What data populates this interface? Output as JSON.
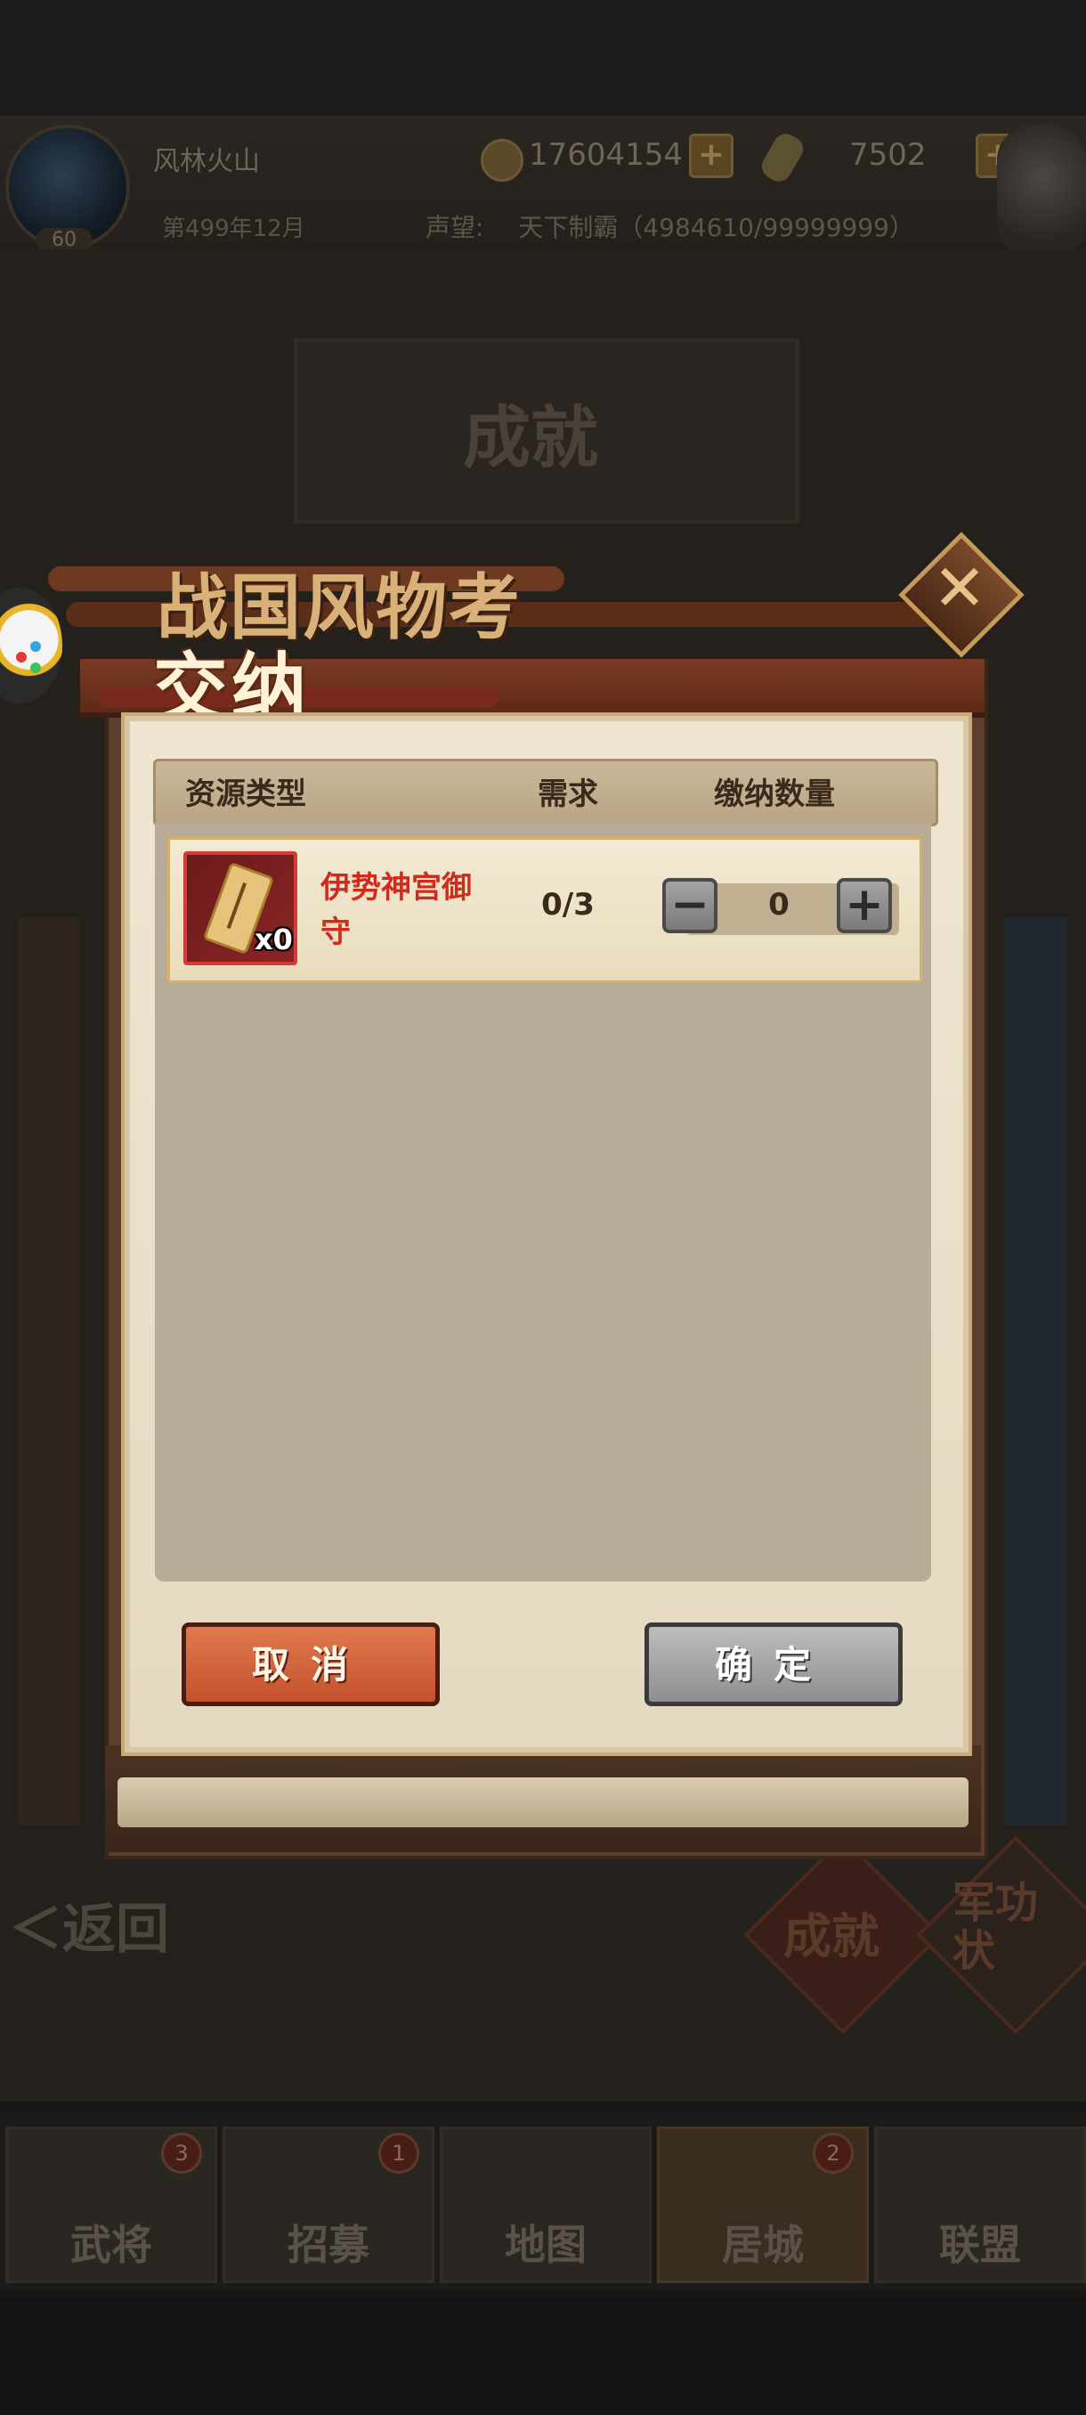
{
  "background": {
    "player_name": "风林火山",
    "level": "60",
    "gold": "17604154",
    "jade": "7502",
    "date": "第499年12月",
    "fame_label": "声望:",
    "fame_value": "天下制霸（4984610/99999999）",
    "screen_title": "成就",
    "back_label": "＜返回",
    "right_tab_1": "成就",
    "right_tab_2": "军功状",
    "nav": [
      {
        "label": "武将",
        "badge": "3"
      },
      {
        "label": "招募",
        "badge": "1"
      },
      {
        "label": "地图",
        "badge": ""
      },
      {
        "label": "居城",
        "badge": "2"
      },
      {
        "label": "联盟",
        "badge": ""
      }
    ]
  },
  "modal": {
    "title": "战国风物考",
    "subtitle": "交纳",
    "close_icon": "close-x-icon",
    "columns": {
      "type": "资源类型",
      "required": "需求",
      "amount": "缴纳数量"
    },
    "items": [
      {
        "name": "伊势神宫御守",
        "owned": "x0",
        "required": "0/3",
        "quantity": "0",
        "icon": "omamori-charm-icon"
      }
    ],
    "cancel_label": "取消",
    "confirm_label": "确定"
  },
  "colors": {
    "accent_red": "#d12b1e",
    "cancel_button": "#c4512d",
    "confirm_button_disabled": "#8e8e8e"
  }
}
